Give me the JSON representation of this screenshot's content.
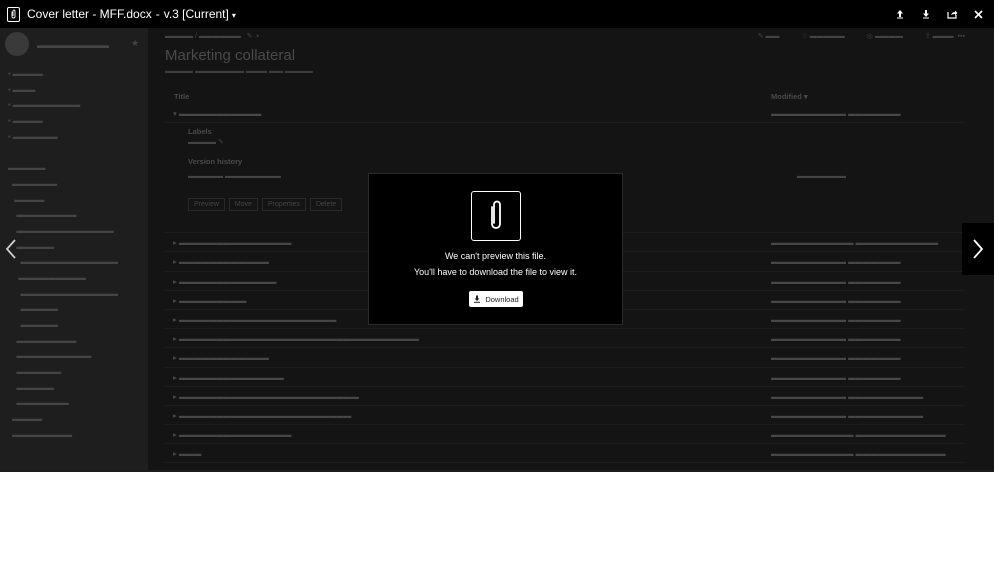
{
  "topbar": {
    "file_name": "Cover letter - MFF.docx",
    "separator": "-",
    "version_label": "v.3 [Current]",
    "version_caret": "▾",
    "actions": [
      "upload-icon",
      "download-icon",
      "share-icon",
      "close-icon"
    ]
  },
  "modal": {
    "icon": "paperclip-icon",
    "line1": "We can't preview this file.",
    "line2": "You'll have to download the file to view it.",
    "download_label": "Download"
  },
  "nav": {
    "prev": "chevron-left-icon",
    "next": "chevron-right-icon"
  },
  "background": {
    "page_title": "Marketing collateral",
    "col_title": "Title",
    "col_modified": "Modified",
    "detail_labels": [
      "Labels",
      "Version history"
    ],
    "detail_buttons": [
      "Preview",
      "Move",
      "Properties",
      "Delete"
    ]
  },
  "colors": {
    "topbar_bg": "#000000",
    "overlay_bg": "#141414",
    "modal_bg": "#000000",
    "button_bg": "#ffffff"
  }
}
